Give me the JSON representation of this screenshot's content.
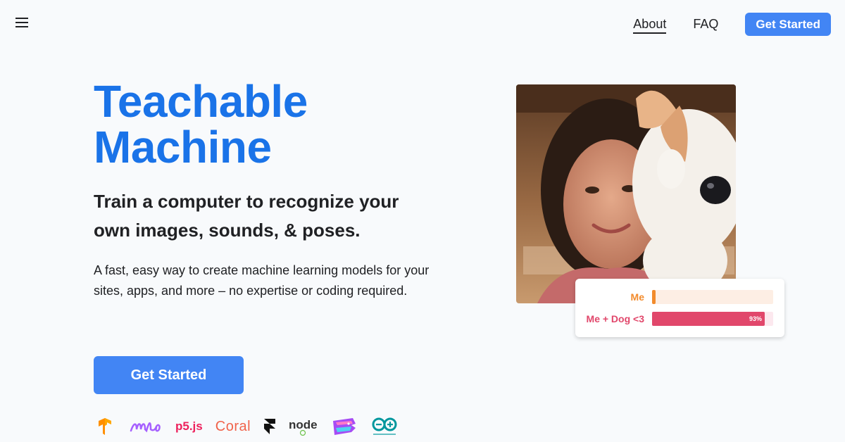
{
  "header": {
    "nav_links": [
      {
        "label": "About"
      },
      {
        "label": "FAQ"
      }
    ],
    "cta_label": "Get Started"
  },
  "hero": {
    "title_line1": "Teachable",
    "title_line2": "Machine",
    "subtitle": "Train a computer to recognize your own images, sounds, & poses.",
    "description": "A fast, easy way to create machine learning models for your sites, apps, and more – no expertise or coding required.",
    "cta_label": "Get Started"
  },
  "logos": [
    {
      "icon": "tensorflow-icon"
    },
    {
      "icon": "ml5-icon"
    },
    {
      "text": "p5.js",
      "icon": "p5js-logo"
    },
    {
      "text": "Coral",
      "icon": "coral-logo"
    },
    {
      "icon": "framer-icon"
    },
    {
      "icon": "node-icon"
    },
    {
      "icon": "glitch-icon"
    },
    {
      "icon": "arduino-icon"
    }
  ],
  "predictions": [
    {
      "label": "Me",
      "value": 0.03,
      "color": "#f28b2c",
      "track": "#fdeee4",
      "shown_pct": ""
    },
    {
      "label": "Me + Dog <3",
      "value": 0.93,
      "color": "#e1476b",
      "track": "#fce8ee",
      "shown_pct": "93%"
    }
  ],
  "colors": {
    "brand_blue": "#1a73e8",
    "button_blue": "#4285f4"
  }
}
